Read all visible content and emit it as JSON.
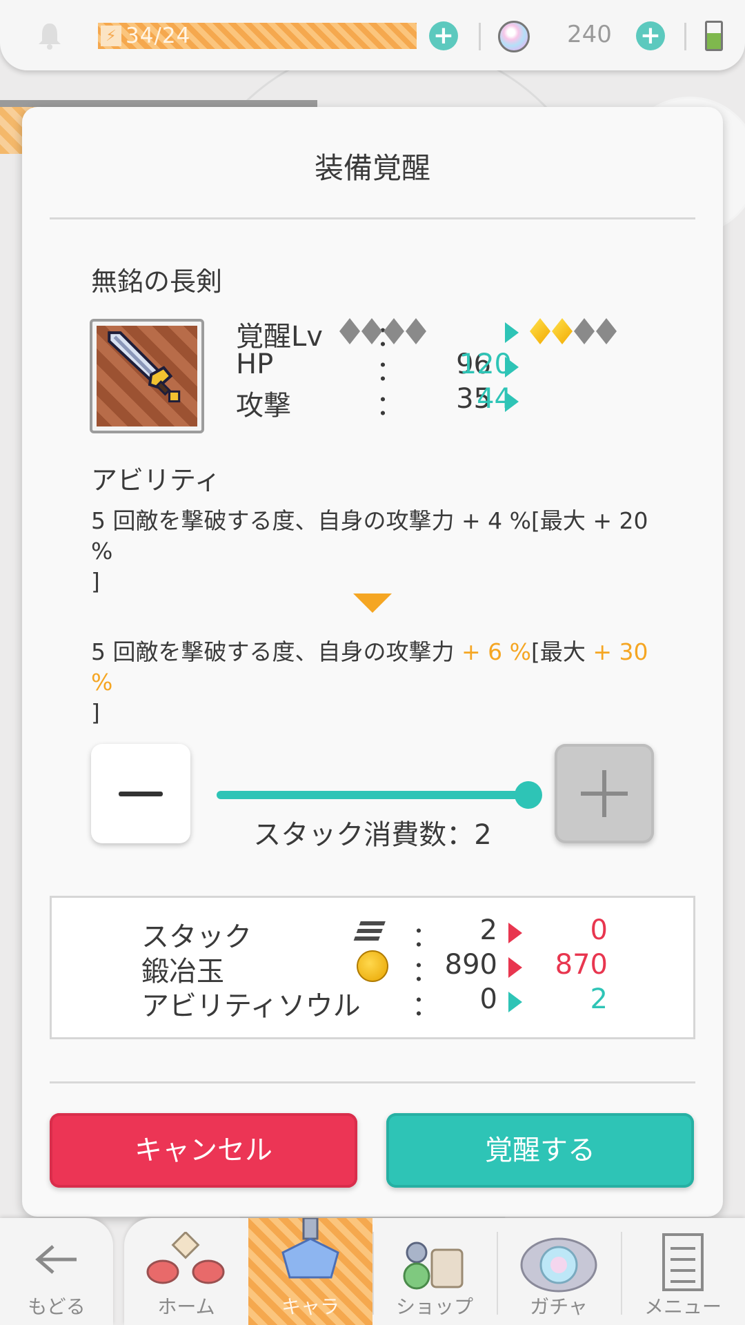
{
  "topbar": {
    "stamina": "34/24",
    "gems": "240",
    "colors": {
      "stamina": "#f5a84e",
      "plus": "#5cc9be"
    }
  },
  "modal": {
    "title": "装備覚醒",
    "item_name": "無銘の長剣",
    "stats": [
      {
        "label": "覚醒Lv",
        "colon": "：",
        "from_level": 0,
        "to_level": 2,
        "max_level": 4
      },
      {
        "label": "HP",
        "colon": "：",
        "from": "96",
        "to": "120"
      },
      {
        "label": "攻撃",
        "colon": "：",
        "from": "35",
        "to": "44"
      }
    ],
    "ability_label": "アビリティ",
    "ability_before": {
      "text_a": "5 回敵を撃破する度、自身の攻撃力",
      "v1": " + 4 %",
      "text_b": "[最大",
      "v2": " + 20 %",
      "text_c": "]"
    },
    "ability_after": {
      "text_a": "5 回敵を撃破する度、自身の攻撃力",
      "v1": " + 6 %",
      "text_b": "[最大",
      "v2": " + 30 %",
      "text_c": "]"
    },
    "slider": {
      "label": "スタック消費数：2",
      "value": 2,
      "max": 2
    },
    "costs": [
      {
        "label": "スタック",
        "icon": "stack-icon",
        "colon": "：",
        "from": "2",
        "to": "0"
      },
      {
        "label": "鍛冶玉",
        "icon": "forge-orb-icon",
        "colon": "：",
        "from": "890",
        "to": "870"
      },
      {
        "label": "アビリティソウル",
        "icon": "",
        "colon": "：",
        "from": "0",
        "to": "2"
      }
    ],
    "buttons": {
      "cancel": "キャンセル",
      "awaken": "覚醒する"
    },
    "colors": {
      "accent": "#2ec4b6",
      "cancel": "#ec3555",
      "highlight": "#f5a623",
      "decrease": "#e8364f"
    }
  },
  "nav": {
    "back": "もどる",
    "tabs": [
      {
        "label": "ホーム",
        "icon": "home-icon"
      },
      {
        "label": "キャラ",
        "icon": "chara-icon",
        "active": true
      },
      {
        "label": "ショップ",
        "icon": "shop-icon"
      },
      {
        "label": "ガチャ",
        "icon": "gacha-icon"
      },
      {
        "label": "メニュー",
        "icon": "menu-icon"
      }
    ]
  }
}
